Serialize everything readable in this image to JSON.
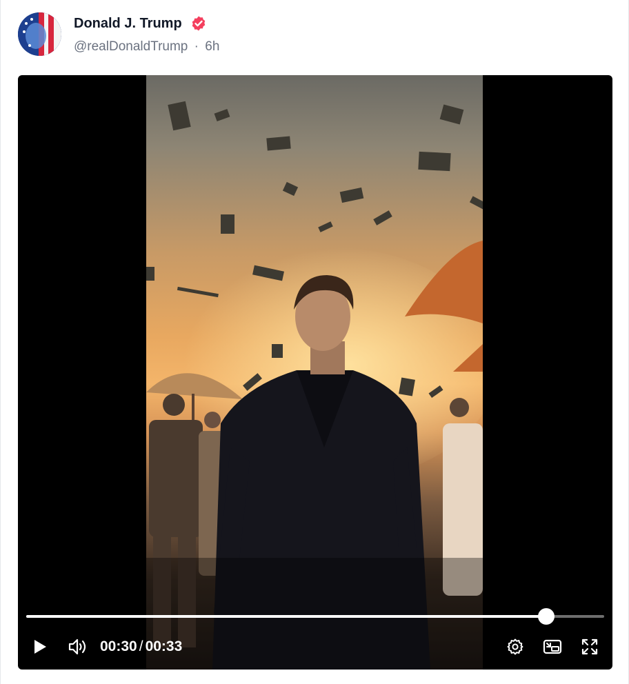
{
  "post": {
    "author_name": "Donald J. Trump",
    "handle": "@realDonaldTrump",
    "separator": "·",
    "time_ago": "6h",
    "verified": true
  },
  "video": {
    "current_time": "00:30",
    "time_separator": "/",
    "duration": "00:33",
    "progress_fraction": 0.9,
    "state": "paused"
  },
  "icons": {
    "verified": "verified-badge-icon",
    "play": "play-icon",
    "volume": "volume-icon",
    "settings": "gear-icon",
    "pip": "picture-in-picture-icon",
    "fullscreen": "fullscreen-icon"
  },
  "colors": {
    "verified_badge": "#f43f5e",
    "name_text": "#111827",
    "meta_text": "#6b7280",
    "player_bg": "#000000",
    "progress_fill": "#ffffff",
    "progress_track": "#c8c8c8"
  }
}
